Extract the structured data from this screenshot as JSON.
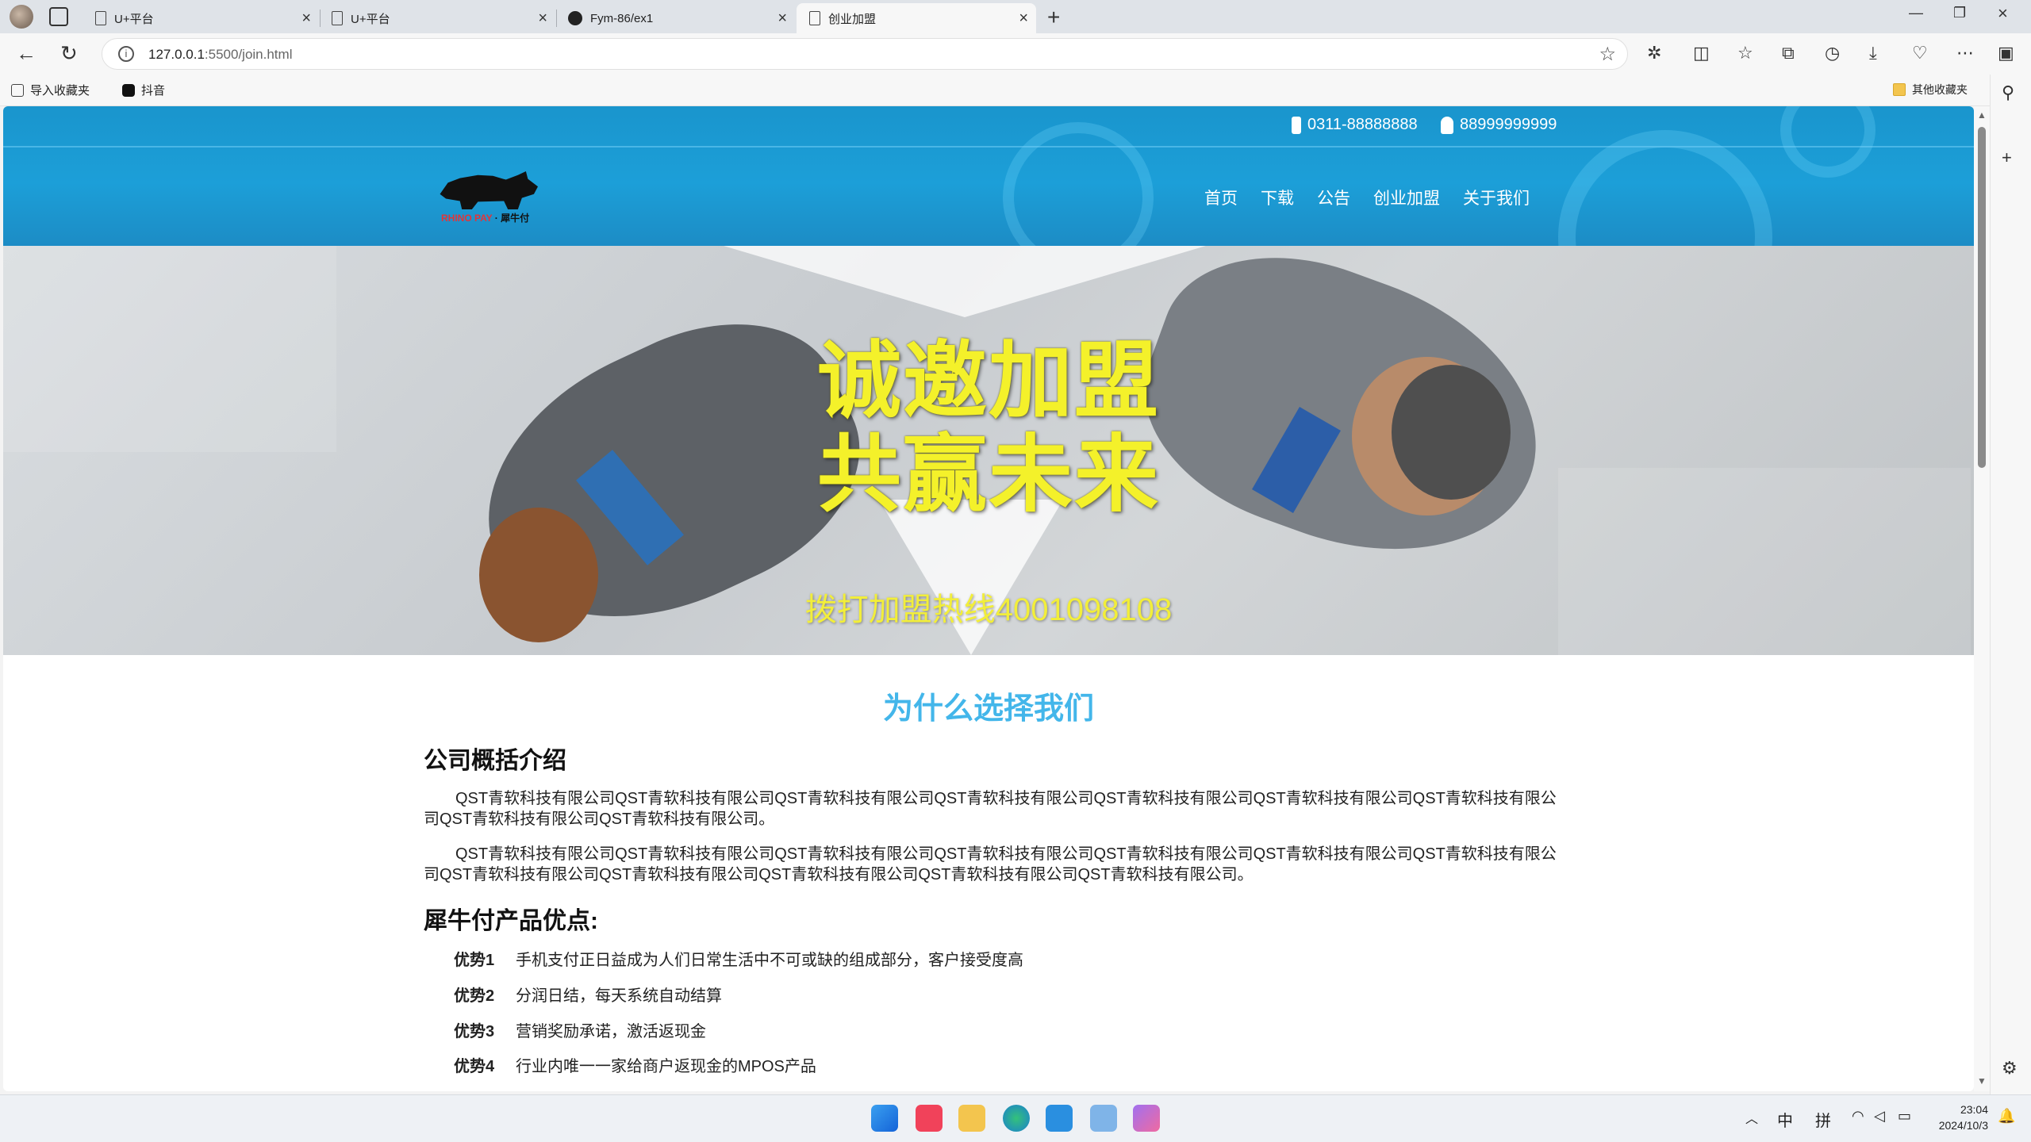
{
  "browser": {
    "tabs": [
      {
        "title": "U+平台"
      },
      {
        "title": "U+平台"
      },
      {
        "title": "Fym-86/ex1"
      },
      {
        "title": "创业加盟"
      }
    ],
    "url_host": "127.0.0.1",
    "url_path": ":5500/join.html",
    "favorites": [
      {
        "label": "导入收藏夹"
      },
      {
        "label": "抖音"
      }
    ],
    "other_favorites": "其他收藏夹"
  },
  "site": {
    "phone": "0311-88888888",
    "qq": "88999999999",
    "logo_text_en": "RHINO PAY",
    "logo_text_cn": "犀牛付",
    "nav": [
      "首页",
      "下载",
      "公告",
      "创业加盟",
      "关于我们"
    ],
    "banner": {
      "line1": "诚邀加盟",
      "line2": "共赢未来",
      "hotline": "拨打加盟热线4001098108"
    },
    "section_title": "为什么选择我们",
    "intro_heading": "公司概括介绍",
    "paragraphs": [
      "QST青软科技有限公司QST青软科技有限公司QST青软科技有限公司QST青软科技有限公司QST青软科技有限公司QST青软科技有限公司QST青软科技有限公司QST青软科技有限公司QST青软科技有限公司。",
      "QST青软科技有限公司QST青软科技有限公司QST青软科技有限公司QST青软科技有限公司QST青软科技有限公司QST青软科技有限公司QST青软科技有限公司QST青软科技有限公司QST青软科技有限公司QST青软科技有限公司QST青软科技有限公司QST青软科技有限公司。"
    ],
    "advantages_heading": "犀牛付产品优点:",
    "advantages": [
      {
        "label": "优势1",
        "text": "手机支付正日益成为人们日常生活中不可或缺的组成部分，客户接受度高"
      },
      {
        "label": "优势2",
        "text": "分润日结，每天系统自动结算"
      },
      {
        "label": "优势3",
        "text": "营销奖励承诺，激活返现金"
      },
      {
        "label": "优势4",
        "text": "行业内唯一一家给商户返现金的MPOS产品"
      }
    ]
  },
  "taskbar": {
    "ime_lang": "中",
    "ime_mode": "拼",
    "time": "23:04",
    "date": "2024/10/3"
  },
  "colors": {
    "header_blue": "#1c9fd8",
    "section_title": "#43b6ea",
    "banner_text": "#f4f12a"
  }
}
